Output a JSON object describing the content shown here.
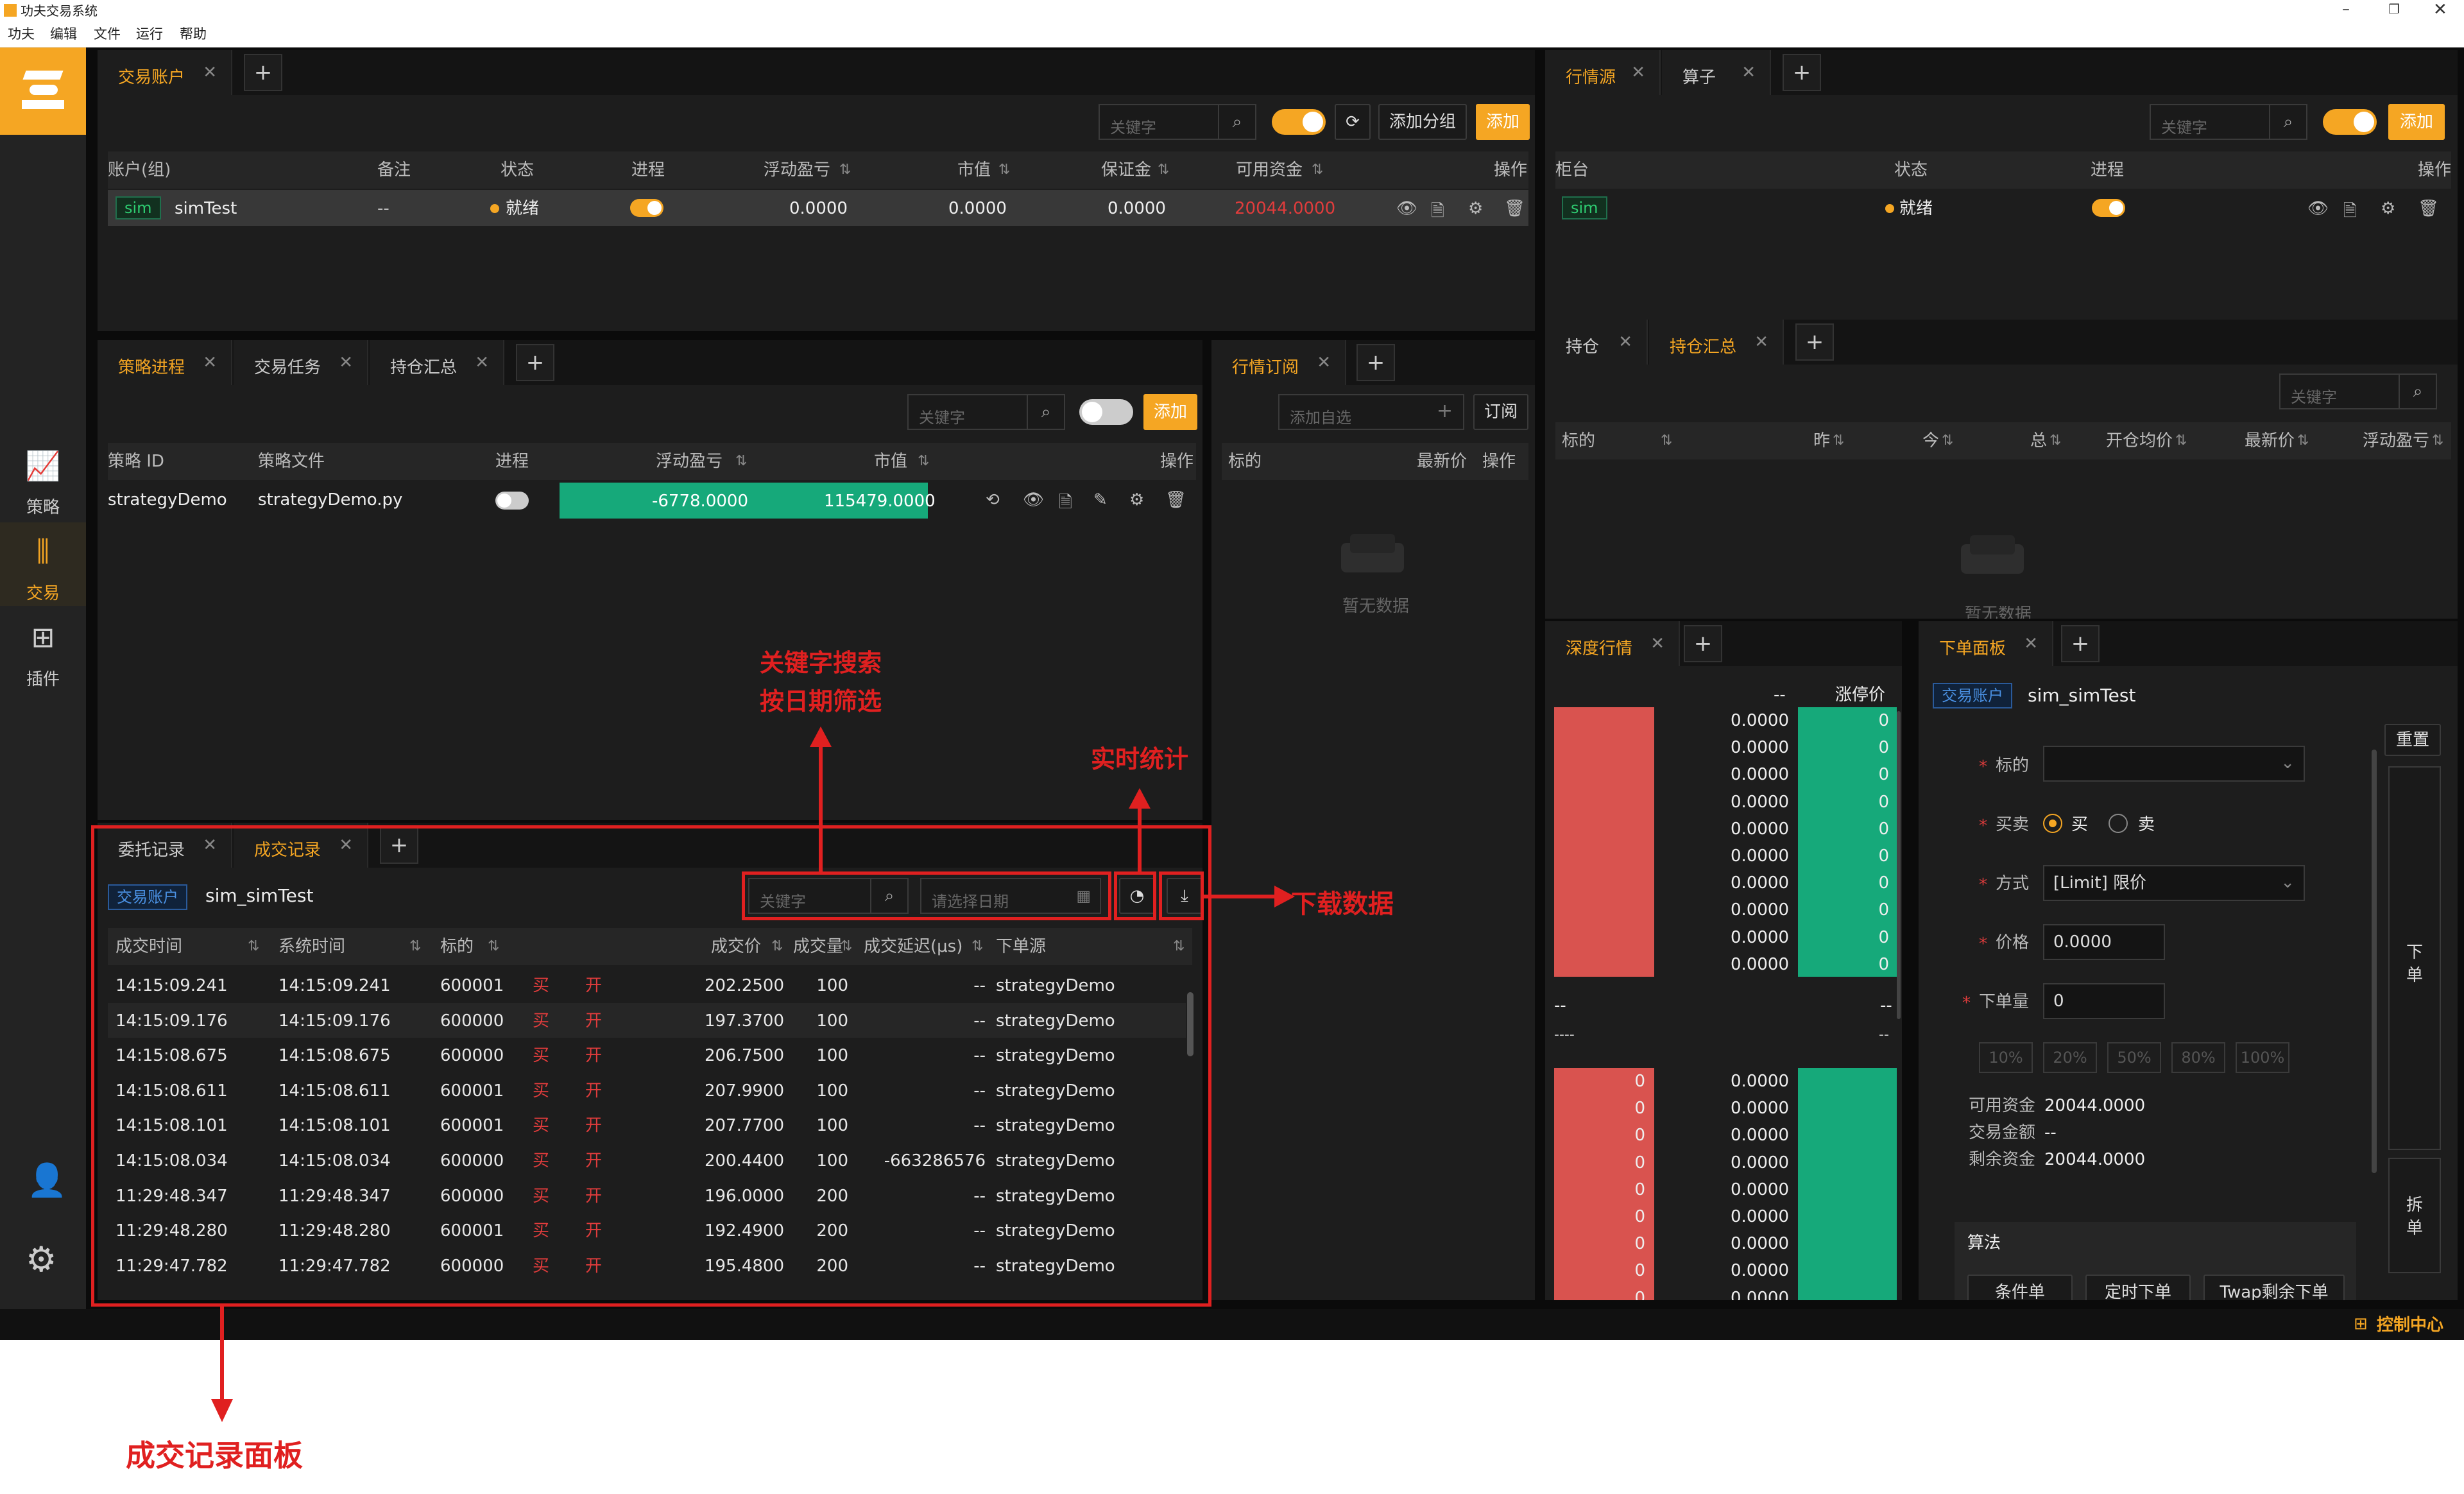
{
  "window": {
    "title": "功夫交易系统",
    "menus": [
      "功夫",
      "编辑",
      "文件",
      "运行",
      "帮助"
    ]
  },
  "sidebar": {
    "items": [
      {
        "label": "策略",
        "icon": "chart-icon"
      },
      {
        "label": "交易",
        "icon": "trade-icon"
      },
      {
        "label": "插件",
        "icon": "plugin-icon"
      }
    ],
    "bottom": [
      "user-icon",
      "settings-icon"
    ]
  },
  "account_panel": {
    "tabs": [
      "交易账户"
    ],
    "search_placeholder": "关键字",
    "add_group": "添加分组",
    "add": "添加",
    "columns": [
      "账户(组)",
      "备注",
      "状态",
      "进程",
      "浮动盈亏",
      "市值",
      "保证金",
      "可用资金",
      "操作"
    ],
    "row": {
      "tag": "sim",
      "name": "simTest",
      "note": "--",
      "status": "就绪",
      "pnl": "0.0000",
      "market_value": "0.0000",
      "margin": "0.0000",
      "available": "20044.0000"
    }
  },
  "market_source_panel": {
    "tabs": [
      "行情源",
      "算子"
    ],
    "search_placeholder": "关键字",
    "add": "添加",
    "columns": [
      "柜台",
      "状态",
      "进程",
      "操作"
    ],
    "row": {
      "tag": "sim",
      "status": "就绪"
    }
  },
  "strategy_panel": {
    "tabs": [
      "策略进程",
      "交易任务",
      "持仓汇总"
    ],
    "search_placeholder": "关键字",
    "add": "添加",
    "columns": [
      "策略 ID",
      "策略文件",
      "进程",
      "浮动盈亏",
      "市值",
      "操作"
    ],
    "row": {
      "id": "strategyDemo",
      "file": "strategyDemo.py",
      "pnl": "-6778.0000",
      "market_value": "115479.0000"
    }
  },
  "subscribe_panel": {
    "tabs": [
      "行情订阅"
    ],
    "placeholder": "添加自选",
    "subscribe": "订阅",
    "columns": [
      "标的",
      "最新价",
      "操作"
    ],
    "empty": "暂无数据"
  },
  "position_panel": {
    "tabs": [
      "持仓",
      "持仓汇总"
    ],
    "search_placeholder": "关键字",
    "columns": [
      "标的",
      "昨",
      "今",
      "总",
      "开仓均价",
      "最新价",
      "浮动盈亏"
    ],
    "empty": "暂无数据"
  },
  "trades_panel": {
    "tabs": [
      "委托记录",
      "成交记录"
    ],
    "account_tag": "交易账户",
    "account_name": "sim_simTest",
    "search_placeholder": "关键字",
    "date_placeholder": "请选择日期",
    "columns": [
      "成交时间",
      "系统时间",
      "标的",
      "",
      "",
      "成交价",
      "成交量",
      "成交延迟(μs)",
      "下单源"
    ],
    "rows": [
      [
        "14:15:09.241",
        "14:15:09.241",
        "600001",
        "买",
        "开",
        "202.2500",
        "100",
        "--",
        "strategyDemo"
      ],
      [
        "14:15:09.176",
        "14:15:09.176",
        "600000",
        "买",
        "开",
        "197.3700",
        "100",
        "--",
        "strategyDemo"
      ],
      [
        "14:15:08.675",
        "14:15:08.675",
        "600000",
        "买",
        "开",
        "206.7500",
        "100",
        "--",
        "strategyDemo"
      ],
      [
        "14:15:08.611",
        "14:15:08.611",
        "600001",
        "买",
        "开",
        "207.9900",
        "100",
        "--",
        "strategyDemo"
      ],
      [
        "14:15:08.101",
        "14:15:08.101",
        "600001",
        "买",
        "开",
        "207.7700",
        "100",
        "--",
        "strategyDemo"
      ],
      [
        "14:15:08.034",
        "14:15:08.034",
        "600000",
        "买",
        "开",
        "200.4400",
        "100",
        "-663286576",
        "strategyDemo"
      ],
      [
        "11:29:48.347",
        "11:29:48.347",
        "600000",
        "买",
        "开",
        "196.0000",
        "200",
        "--",
        "strategyDemo"
      ],
      [
        "11:29:48.280",
        "11:29:48.280",
        "600001",
        "买",
        "开",
        "192.4900",
        "200",
        "--",
        "strategyDemo"
      ],
      [
        "11:29:47.782",
        "11:29:47.782",
        "600000",
        "买",
        "开",
        "195.4800",
        "200",
        "--",
        "strategyDemo"
      ]
    ]
  },
  "depth_panel": {
    "tabs": [
      "深度行情"
    ],
    "head_left": "--",
    "head_right": "涨停价",
    "ask_prices": [
      "0.0000",
      "0.0000",
      "0.0000",
      "0.0000",
      "0.0000",
      "0.0000",
      "0.0000",
      "0.0000",
      "0.0000",
      "0.0000"
    ],
    "ask_vols": [
      "0",
      "0",
      "0",
      "0",
      "0",
      "0",
      "0",
      "0",
      "0",
      "0"
    ],
    "mid_left": "--",
    "mid_right": "--",
    "mid_left2": "----",
    "mid_right2": "--",
    "bid_vols": [
      "0",
      "0",
      "0",
      "0",
      "0",
      "0",
      "0",
      "0",
      "0"
    ],
    "bid_prices": [
      "0.0000",
      "0.0000",
      "0.0000",
      "0.0000",
      "0.0000",
      "0.0000",
      "0.0000",
      "0.0000",
      "0.0000"
    ]
  },
  "order_panel": {
    "tabs": [
      "下单面板"
    ],
    "account_tag": "交易账户",
    "account_name": "sim_simTest",
    "reset": "重置",
    "labels": {
      "symbol": "标的",
      "side": "买卖",
      "buy": "买",
      "sell": "卖",
      "mode": "方式",
      "mode_value": "[Limit] 限价",
      "price": "价格",
      "price_value": "0.0000",
      "volume": "下单量",
      "volume_value": "0"
    },
    "percents": [
      "10%",
      "20%",
      "50%",
      "80%",
      "100%"
    ],
    "funds": [
      {
        "k": "可用资金",
        "v": "20044.0000"
      },
      {
        "k": "交易金额",
        "v": "--"
      },
      {
        "k": "剩余资金",
        "v": "20044.0000"
      }
    ],
    "algo": "算法",
    "algo_buttons": [
      "条件单",
      "定时下单",
      "Twap剩余下单"
    ],
    "place": "下单",
    "split": "拆单"
  },
  "status_bar": {
    "label": "控制中心"
  },
  "annotations": {
    "search": "关键字搜索",
    "filter": "按日期筛选",
    "stats": "实时统计",
    "download": "下载数据",
    "panel": "成交记录面板"
  }
}
